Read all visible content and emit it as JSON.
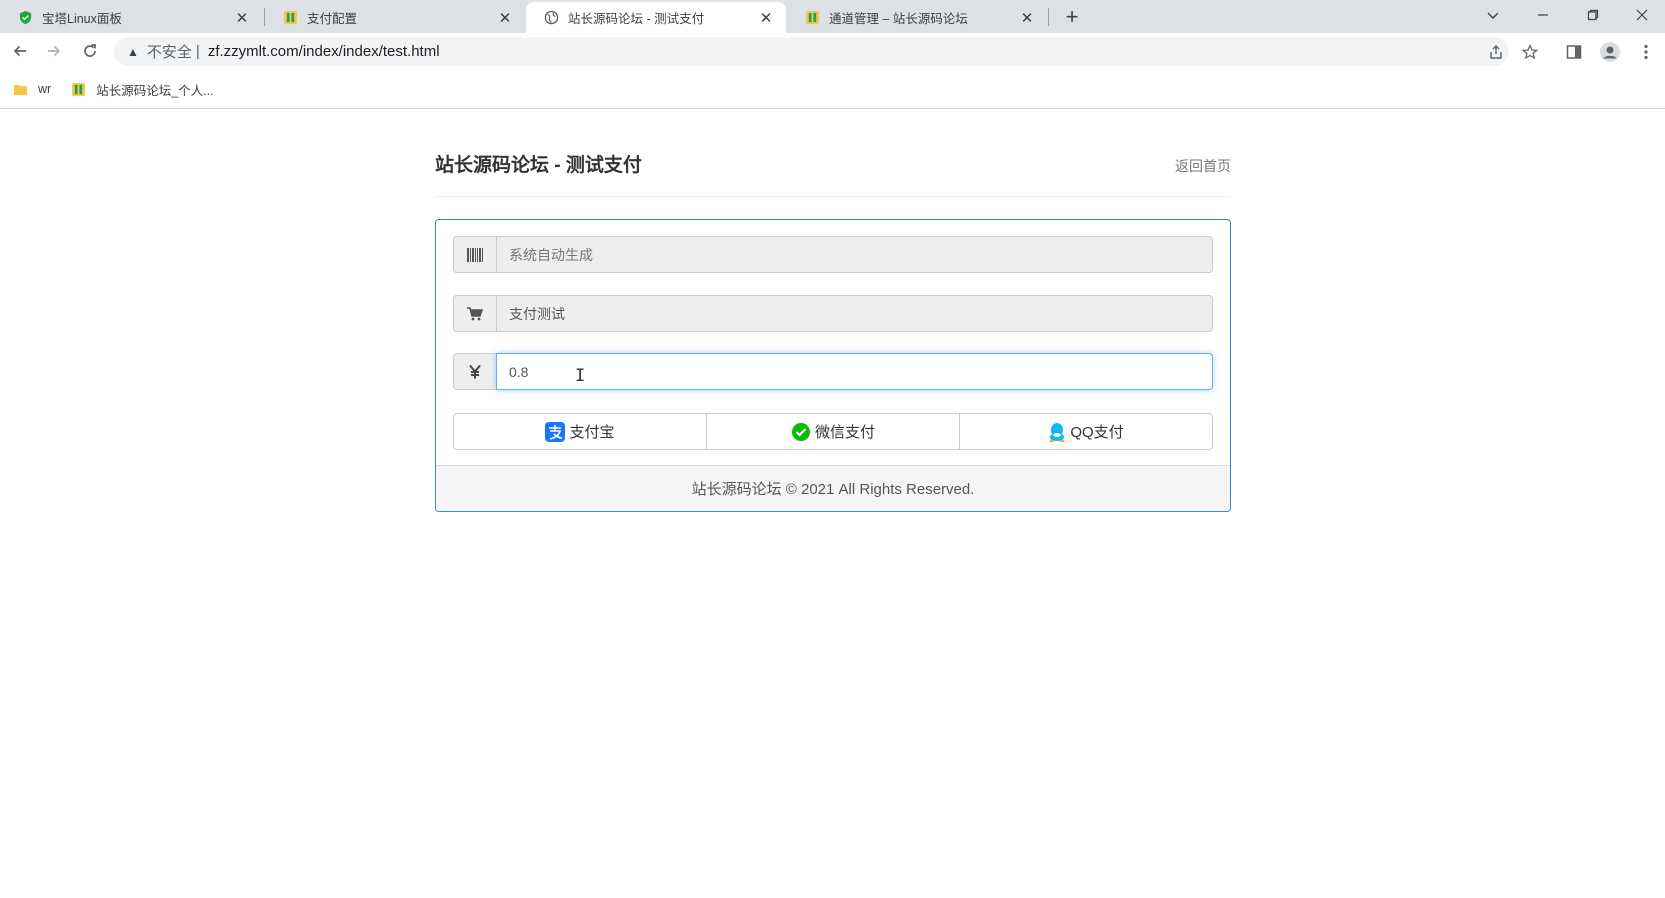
{
  "browser": {
    "tabs": [
      {
        "title": "宝塔Linux面板",
        "icon": "bt-shield-icon"
      },
      {
        "title": "支付配置",
        "icon": "site-favicon"
      },
      {
        "title": "站长源码论坛 - 测试支付",
        "icon": "globe-icon",
        "active": true
      },
      {
        "title": "通道管理 – 站长源码论坛",
        "icon": "site-favicon"
      }
    ],
    "address": {
      "security_label": "不安全",
      "separator": "|",
      "url": "zf.zzymlt.com/index/index/test.html"
    },
    "bookmarks": [
      {
        "label": "wr",
        "icon": "folder-icon"
      },
      {
        "label": "站长源码论坛_个人...",
        "icon": "site-favicon"
      }
    ]
  },
  "page": {
    "title": "站长源码论坛 - 测试支付",
    "home_link": "返回首页",
    "form": {
      "order_no_placeholder": "系统自动生成",
      "product_name_value": "支付测试",
      "amount_value": "0.8"
    },
    "buttons": {
      "alipay": "支付宝",
      "wechat": "微信支付",
      "qq": "QQ支付"
    },
    "footer": "站长源码论坛 © 2021 All Rights Reserved."
  },
  "colors": {
    "panel_border": "#3a8cbf",
    "alipay_blue": "#1677ff",
    "wechat_green": "#09bb07",
    "qq_blue": "#12b7f5"
  }
}
